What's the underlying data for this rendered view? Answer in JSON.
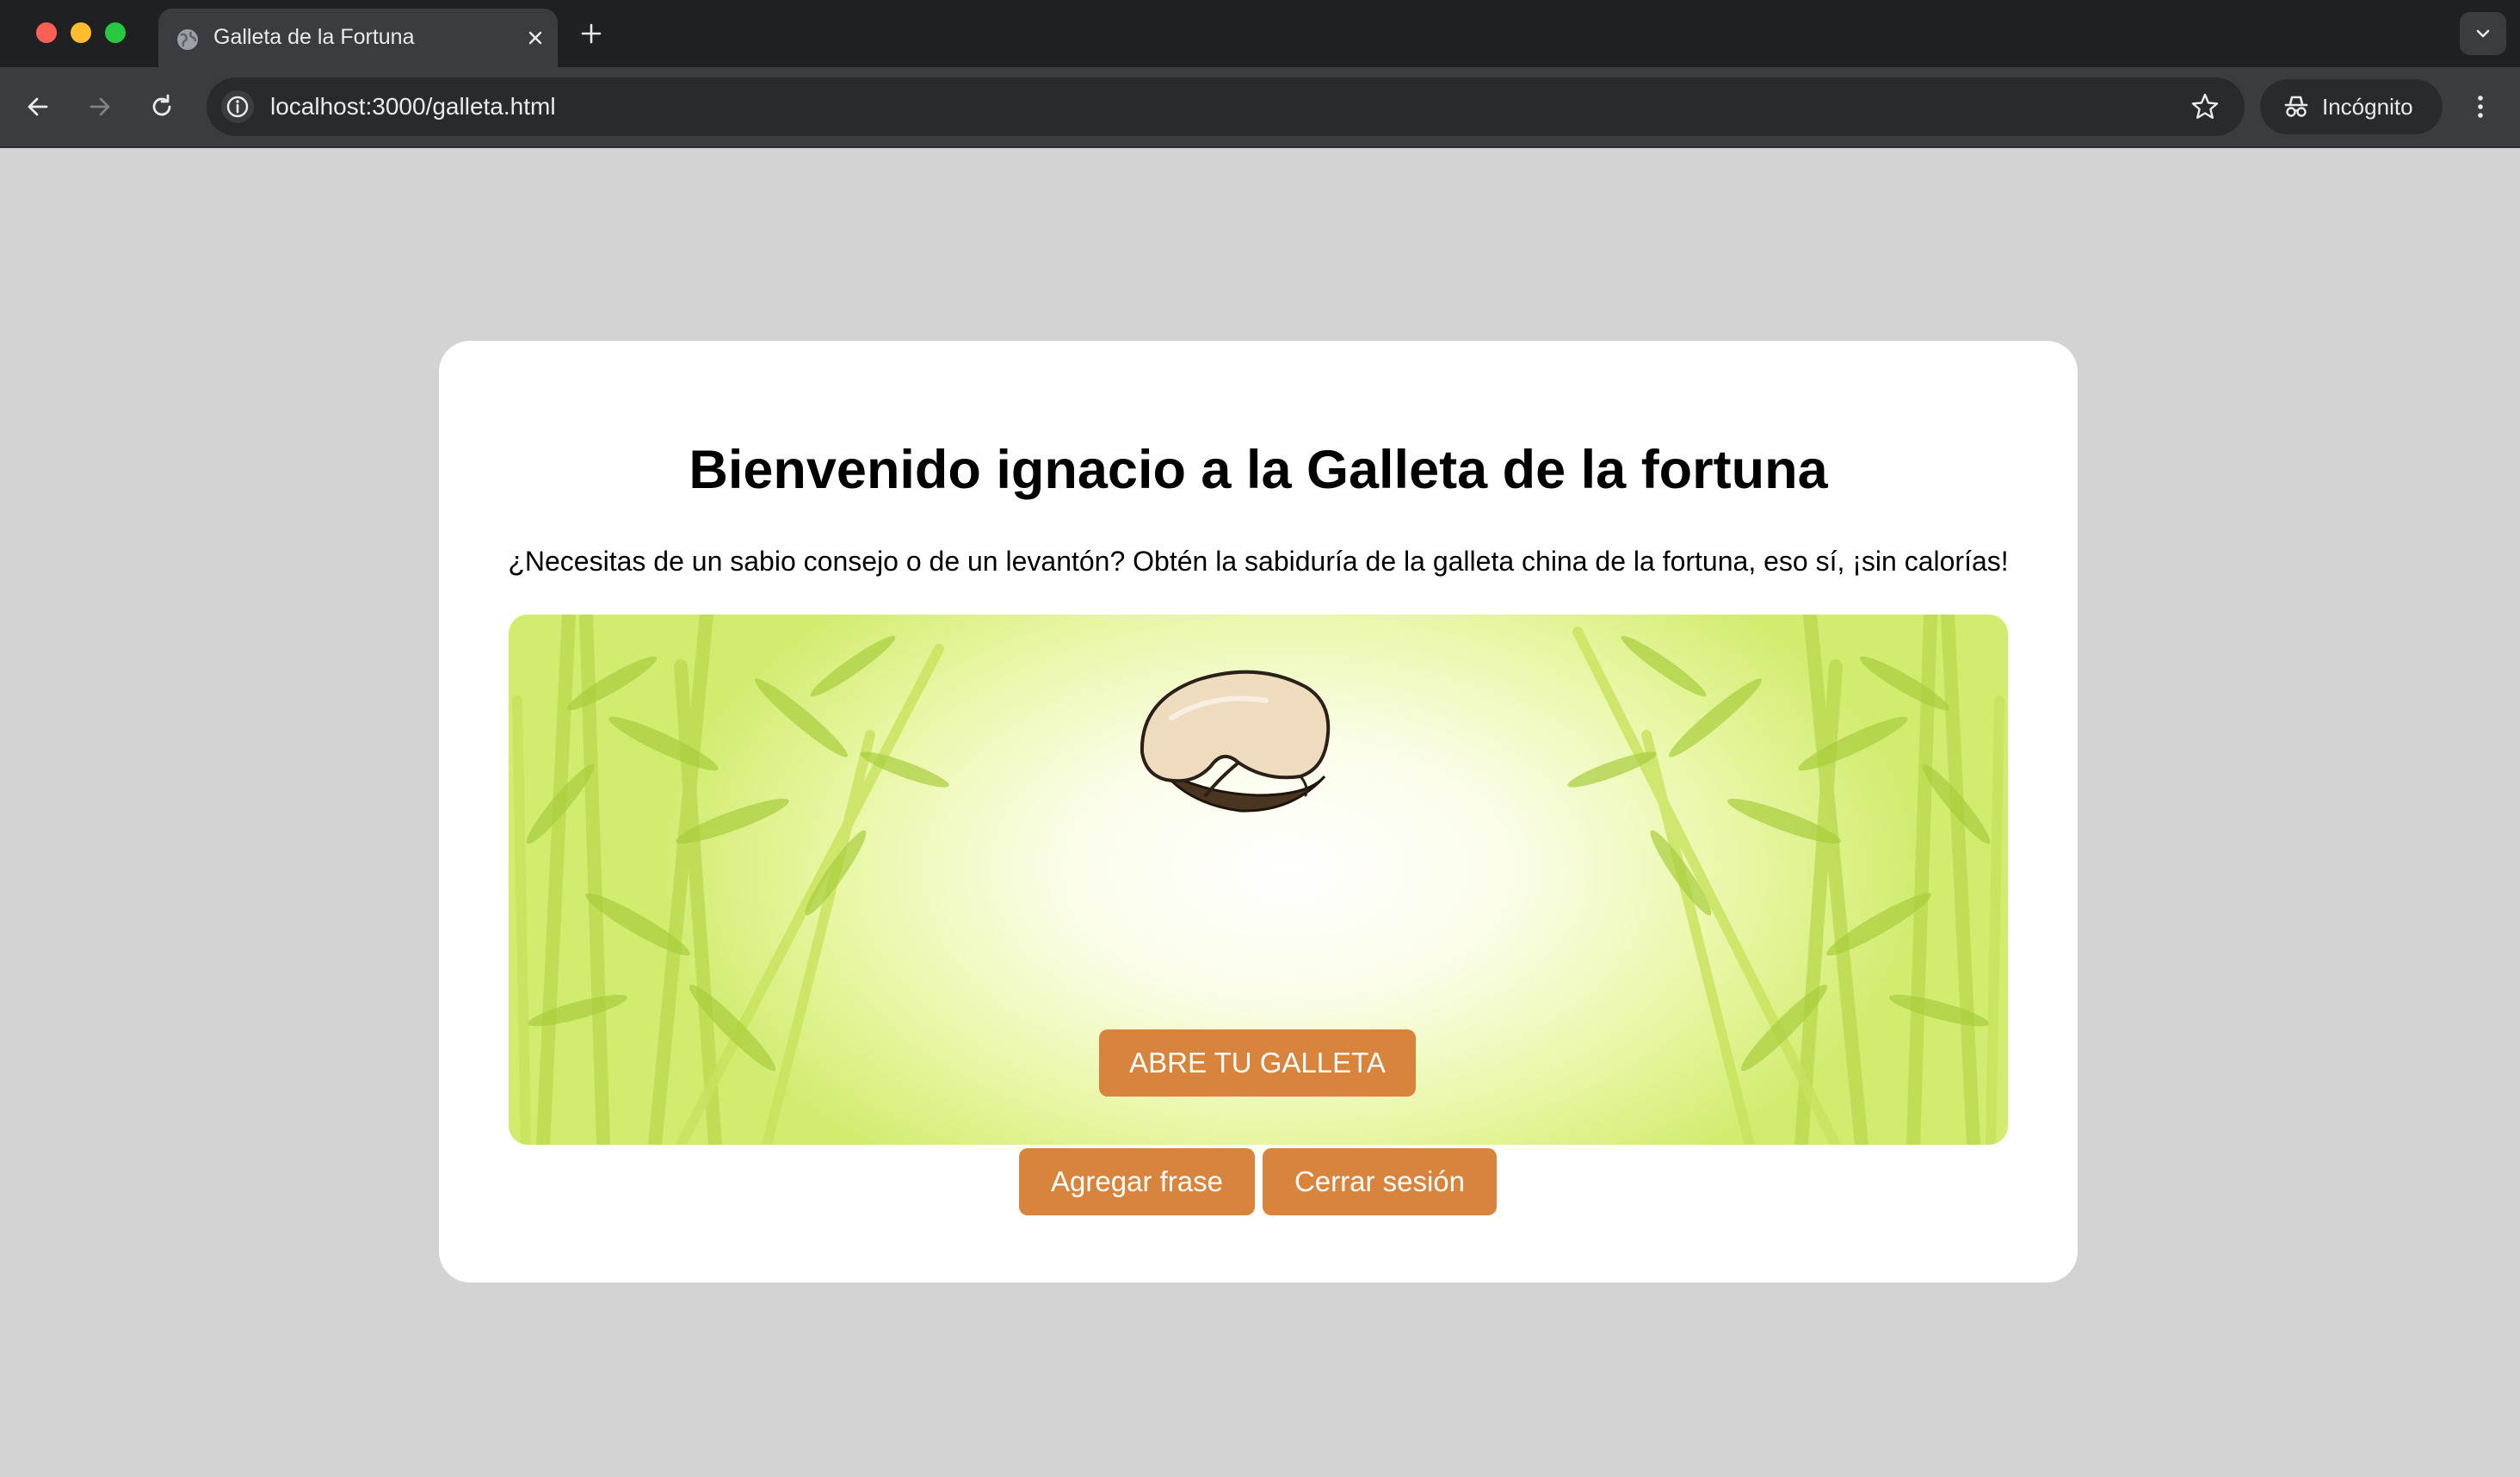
{
  "browser": {
    "tab_title": "Galleta de la Fortuna",
    "url": "localhost:3000/galleta.html",
    "profile_label": "Incógnito",
    "icons": [
      "globe-icon",
      "close-icon",
      "plus-icon",
      "chevron-down-icon",
      "back-arrow-icon",
      "forward-arrow-icon",
      "reload-icon",
      "info-icon",
      "star-icon",
      "incognito-icon",
      "kebab-menu-icon"
    ]
  },
  "page": {
    "title": "Bienvenido ignacio a la Galleta de la fortuna",
    "subtitle": "¿Necesitas de un sabio consejo o de un levantón? Obtén la sabiduría de la galleta china de la fortuna, eso sí, ¡sin calorías!",
    "open_button": "ABRE TU GALLETA",
    "add_phrase_button": "Agregar frase",
    "logout_button": "Cerrar sesión"
  },
  "colors": {
    "page_background": "#d3d3d3",
    "card_background": "#ffffff",
    "button_orange": "#d8843d",
    "bamboo_green": "#c7e35a"
  }
}
